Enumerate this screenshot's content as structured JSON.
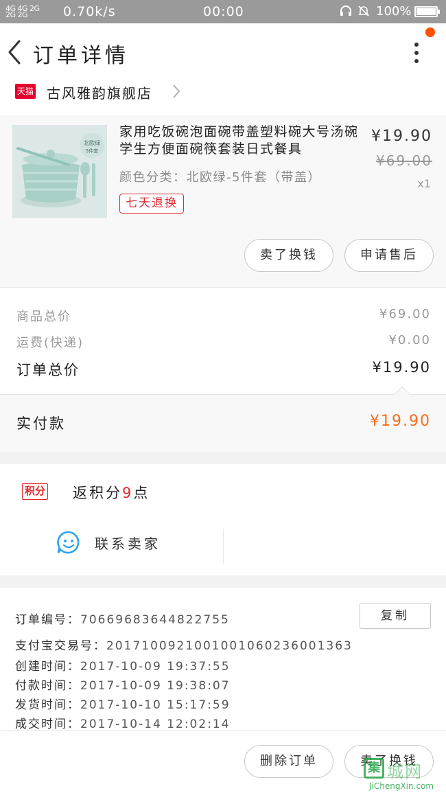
{
  "status_bar": {
    "signal": "4G 4G 2G\n2G",
    "speed": "0.70k/s",
    "time": "00:00",
    "battery_pct": "100%",
    "battery_level": 1.0
  },
  "header": {
    "title": "订单详情"
  },
  "shop": {
    "tmall_badge": "天猫",
    "name": "古风雅韵旗舰店"
  },
  "product": {
    "name": "家用吃饭碗泡面碗带盖塑料碗大号汤碗学生方便面碗筷套装日式餐具",
    "spec": "颜色分类：北欧绿-5件套（带盖）",
    "tag": "七天退换",
    "price": "¥19.90",
    "original_price": "¥69.00",
    "quantity": "x1",
    "thumb_label_1": "北欧绿",
    "thumb_label_2": "5件套",
    "buttons": {
      "refund": "卖了换钱",
      "after_sale": "申请售后"
    }
  },
  "summary": {
    "goods_total_label": "商品总价",
    "goods_total_value": "¥69.00",
    "shipping_label": "运费(快递)",
    "shipping_value": "¥0.00",
    "order_total_label": "订单总价",
    "order_total_value": "¥19.90"
  },
  "payment": {
    "label": "实付款",
    "value": "¥19.90"
  },
  "points": {
    "badge": "积分",
    "prefix": "返积分",
    "count": "9",
    "suffix": "点"
  },
  "contact": {
    "label": "联系卖家"
  },
  "order_info": {
    "order_no_label": "订单编号：",
    "order_no": "70669683644822755",
    "copy_button": "复制",
    "alipay_label": "支付宝交易号：",
    "alipay_no": "2017100921001001060236001363",
    "created_label": "创建时间：",
    "created": "2017-10-09 19:37:55",
    "paid_label": "付款时间：",
    "paid": "2017-10-09 19:38:07",
    "shipped_label": "发货时间：",
    "shipped": "2017-10-10 15:17:59",
    "completed_label": "成交时间：",
    "completed": "2017-10-14 12:02:14"
  },
  "bottom_bar": {
    "delete": "删除订单",
    "resell": "卖了换钱"
  },
  "watermark": {
    "logo": "集",
    "text": "城网",
    "url": "JiChengXin.com"
  },
  "colors": {
    "accent_red": "#e5262b",
    "accent_orange": "#ff6a1a",
    "tmall_red": "#e5002d",
    "notification_dot": "#ff5000",
    "contact_icon_blue": "#2aa3f0"
  },
  "icons": {
    "back": "chevron-left-icon",
    "more": "more-vertical-icon",
    "shop_chevron": "chevron-right-icon",
    "contact": "chat-smile-icon",
    "headset": "headset-icon",
    "mute": "bell-off-icon"
  }
}
